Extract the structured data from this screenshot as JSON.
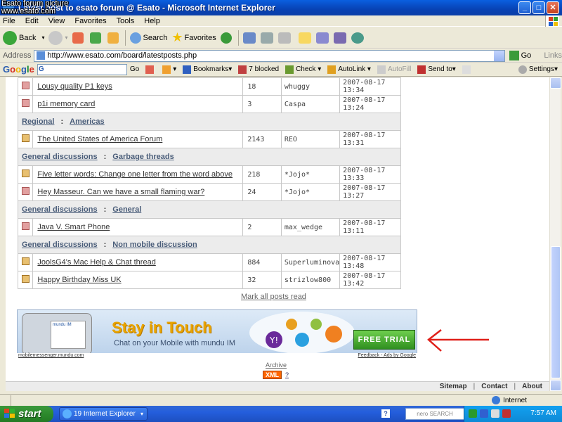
{
  "overlay": {
    "line1": "Esato forum picture",
    "line2": "www.esato.com"
  },
  "window": {
    "title": "Latest post to esato forum @ Esato - Microsoft Internet Explorer",
    "min": "_",
    "max": "□",
    "close": "✕"
  },
  "menu": [
    "File",
    "Edit",
    "View",
    "Favorites",
    "Tools",
    "Help"
  ],
  "toolbar": {
    "back": "Back",
    "search": "Search",
    "favorites": "Favorites"
  },
  "address": {
    "label": "Address",
    "url": "http://www.esato.com/board/latestposts.php",
    "go": "Go",
    "links": "Links"
  },
  "googlebar": {
    "logo": [
      "G",
      "o",
      "o",
      "g",
      "l",
      "e"
    ],
    "go": "Go",
    "bookmarks": "Bookmarks▾",
    "blocked": "7 blocked",
    "check": "Check ▾",
    "autolink": "AutoLink ▾",
    "autofill": "AutoFill",
    "sendto": "Send to▾",
    "settings": "Settings▾"
  },
  "rows": [
    {
      "kind": "topic",
      "hot": false,
      "title": "Lousy quality P1 keys",
      "replies": "18",
      "user": "whuggy",
      "date": "2007-08-17 13:34"
    },
    {
      "kind": "topic",
      "hot": false,
      "title": "p1i memory card",
      "replies": "3",
      "user": "Caspa",
      "date": "2007-08-17 13:24"
    },
    {
      "kind": "header",
      "cat": "Regional",
      "forum": "Americas"
    },
    {
      "kind": "topic",
      "hot": true,
      "title": "The United States of America Forum",
      "replies": "2143",
      "user": "REO",
      "date": "2007-08-17 13:31"
    },
    {
      "kind": "header",
      "cat": "General discussions",
      "forum": "Garbage threads"
    },
    {
      "kind": "topic",
      "hot": true,
      "title": "Five letter words: Change one letter from the word above",
      "replies": "218",
      "user": "*Jojo*",
      "date": "2007-08-17 13:33"
    },
    {
      "kind": "topic",
      "hot": false,
      "title": "Hey Masseur. Can we have a small flaming war?",
      "replies": "24",
      "user": "*Jojo*",
      "date": "2007-08-17 13:27"
    },
    {
      "kind": "header",
      "cat": "General discussions",
      "forum": "General"
    },
    {
      "kind": "topic",
      "hot": false,
      "title": "Java V. Smart Phone",
      "replies": "2",
      "user": "max_wedge",
      "date": "2007-08-17 13:11"
    },
    {
      "kind": "header",
      "cat": "General discussions",
      "forum": "Non mobile discussion"
    },
    {
      "kind": "topic",
      "hot": true,
      "title": "JoolsG4's Mac Help & Chat thread",
      "replies": "884",
      "user": "Superluminova",
      "date": "2007-08-17 13:48"
    },
    {
      "kind": "topic",
      "hot": true,
      "title": "Happy Birthday Miss UK",
      "replies": "32",
      "user": "strizlow800",
      "date": "2007-08-17 13:42"
    }
  ],
  "mark_all": "Mark all posts read",
  "banner": {
    "phone_text": "mundu IM",
    "headline": "Stay in Touch",
    "sub": "Chat on your Mobile with mundu IM",
    "cta": "FREE TRIAL",
    "url": "mobilemessenger.mundu.com",
    "feedback": "Feedback - Ads by Google"
  },
  "archive": "Archive",
  "xml": "XML",
  "help": "?",
  "footer": {
    "sitemap": "Sitemap",
    "contact": "Contact",
    "about": "About"
  },
  "status": {
    "zone": "Internet"
  },
  "taskbar": {
    "start": "start",
    "item": "19 Internet Explorer",
    "nero": "nero SEARCH",
    "clock": "7:57 AM",
    "help": "?"
  },
  "colors": {
    "accent": "#0a5fe0",
    "arrow": "#e0201a",
    "cta": "#2f8f1f",
    "headline": "#e9a400"
  }
}
